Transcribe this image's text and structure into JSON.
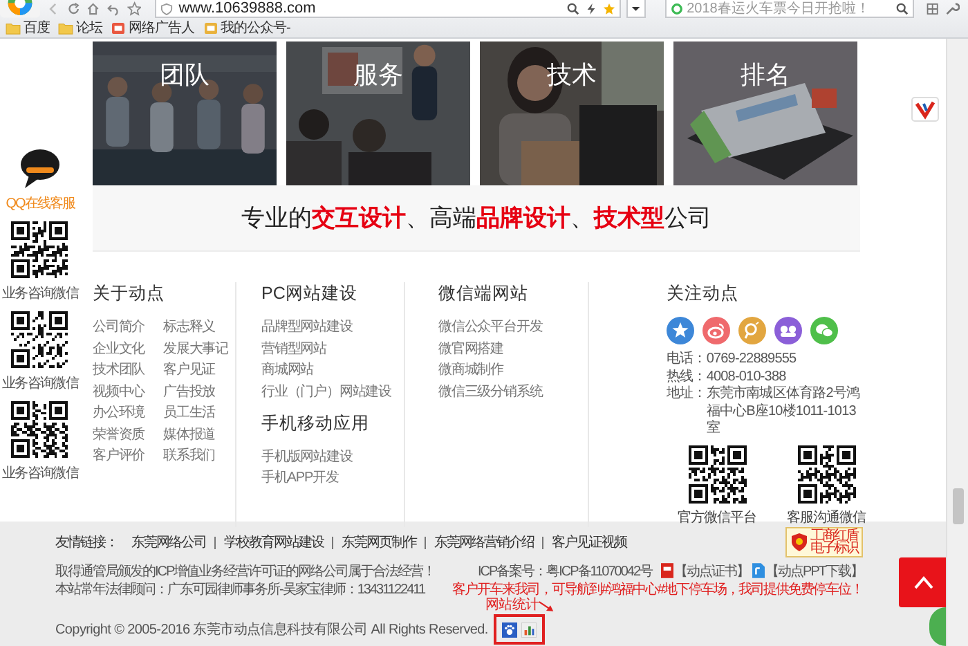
{
  "browser": {
    "address": "www.10639888.com",
    "search": {
      "placeholder": "2018春运火车票今日开抢啦！"
    },
    "bookmarks": [
      {
        "label": "百度",
        "kind": "folder"
      },
      {
        "label": "论坛",
        "kind": "folder"
      },
      {
        "label": "网络广告人",
        "kind": "site"
      },
      {
        "label": "我的公众号-",
        "kind": "site"
      }
    ]
  },
  "side_panel": {
    "service_label": "QQ在线客服",
    "qr_codes": [
      {
        "caption": "业务咨询微信"
      },
      {
        "caption": "业务咨询微信"
      },
      {
        "caption": "业务咨询微信"
      }
    ]
  },
  "tiles": [
    {
      "label": "团队",
      "kind": "team"
    },
    {
      "label": "服务",
      "kind": "seminar"
    },
    {
      "label": "技术",
      "kind": "desk"
    },
    {
      "label": "排名",
      "kind": "tablet"
    }
  ],
  "slogan": "专业的**交互设计**、高端**品牌设计**、**技术型**公司",
  "footer_columns": [
    {
      "kind": "grid",
      "sections": [
        {
          "title": "关于动点",
          "links": [
            "公司简介",
            "标志释义",
            "企业文化",
            "发展大事记",
            "技术团队",
            "客户见证",
            "视频中心",
            "广告投放",
            "办公环境",
            "员工生活",
            "荣誉资质",
            "媒体报道",
            "客户评价",
            "联系我们"
          ]
        }
      ]
    },
    {
      "kind": "list",
      "sections": [
        {
          "title": "PC网站建设",
          "links": [
            "品牌型网站建设",
            "营销型网站",
            "商城网站",
            "行业（门户）网站建设"
          ]
        },
        {
          "title": "手机移动应用",
          "links": [
            "手机版网站建设",
            "手机APP开发"
          ]
        }
      ]
    },
    {
      "kind": "list",
      "sections": [
        {
          "title": "微信端网站",
          "links": [
            "微信公众平台开发",
            "微官网搭建",
            "微商城制作",
            "微信三级分销系统"
          ]
        }
      ]
    }
  ],
  "follow": {
    "title": "关注动点",
    "social": [
      {
        "kind": "star",
        "color": "#3d87d8"
      },
      {
        "kind": "ring",
        "color": "#ef6a6d"
      },
      {
        "kind": "lens",
        "color": "#e2a640"
      },
      {
        "kind": "group",
        "color": "#8b5fd8"
      },
      {
        "kind": "chat",
        "color": "#4fbf4a"
      }
    ],
    "contacts": [
      {
        "label": "电话：",
        "value": "0769-22889555"
      },
      {
        "label": "热线：",
        "value": "4008-010-388"
      },
      {
        "label": "地址：",
        "value": "东莞市南城区体育路2号鸿福中心B座10楼1011-1013室"
      }
    ],
    "qr_codes": [
      {
        "caption": "官方微信平台"
      },
      {
        "caption": "客服沟通微信"
      }
    ]
  },
  "bottom": {
    "links_label": "友情链接：",
    "links": [
      "东莞网络公司",
      "学校教育网站建设",
      "东莞网页制作",
      "东莞网络营销介绍",
      "客户见证视频"
    ],
    "badge_lines": [
      "工商红盾",
      "电子标识"
    ],
    "notices": [
      "取得通管局颁发的ICP增值业务经营许可证的网络公司属于合法经营！",
      "本站常年法律顾问：广东可园律师事务所-吴家宝律师：13431122411"
    ],
    "parking_notice": "客户开车来我司，可导航到#鸿福中心#地下停车场，我司提供免费停车位！",
    "stats_label": "网站统计",
    "copyright": "Copyright © 2005-2016 东莞市动点信息科技有限公司 All Rights Reserved.",
    "icp": "ICP备案号：粤ICP备11070042号",
    "downloads": [
      {
        "label": "【动点证书】",
        "kind": "certificate"
      },
      {
        "label": "【动点PPT下载】",
        "kind": "document"
      }
    ]
  }
}
